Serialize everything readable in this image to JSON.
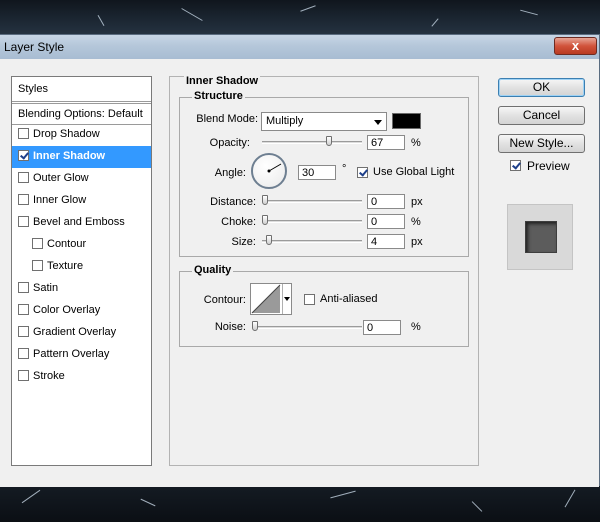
{
  "window": {
    "title": "Layer Style",
    "close_glyph": "x"
  },
  "styles_list": {
    "header": "Styles",
    "blending_options": "Blending Options: Default",
    "items": [
      {
        "label": "Drop Shadow",
        "checked": false,
        "active": false,
        "indent": false
      },
      {
        "label": "Inner Shadow",
        "checked": true,
        "active": true,
        "indent": false
      },
      {
        "label": "Outer Glow",
        "checked": false,
        "active": false,
        "indent": false
      },
      {
        "label": "Inner Glow",
        "checked": false,
        "active": false,
        "indent": false
      },
      {
        "label": "Bevel and Emboss",
        "checked": false,
        "active": false,
        "indent": false
      },
      {
        "label": "Contour",
        "checked": false,
        "active": false,
        "indent": true
      },
      {
        "label": "Texture",
        "checked": false,
        "active": false,
        "indent": true
      },
      {
        "label": "Satin",
        "checked": false,
        "active": false,
        "indent": false
      },
      {
        "label": "Color Overlay",
        "checked": false,
        "active": false,
        "indent": false
      },
      {
        "label": "Gradient Overlay",
        "checked": false,
        "active": false,
        "indent": false
      },
      {
        "label": "Pattern Overlay",
        "checked": false,
        "active": false,
        "indent": false
      },
      {
        "label": "Stroke",
        "checked": false,
        "active": false,
        "indent": false
      }
    ]
  },
  "inner_shadow": {
    "title": "Inner Shadow",
    "structure": {
      "title": "Structure",
      "blend_mode_label": "Blend Mode:",
      "blend_mode_value": "Multiply",
      "shadow_color": "#000000",
      "opacity_label": "Opacity:",
      "opacity_value": "67",
      "opacity_unit": "%",
      "angle_label": "Angle:",
      "angle_value": "30",
      "angle_unit": "°",
      "use_global_light_label": "Use Global Light",
      "use_global_light_checked": true,
      "distance_label": "Distance:",
      "distance_value": "0",
      "distance_unit": "px",
      "choke_label": "Choke:",
      "choke_value": "0",
      "choke_unit": "%",
      "size_label": "Size:",
      "size_value": "4",
      "size_unit": "px"
    },
    "quality": {
      "title": "Quality",
      "contour_label": "Contour:",
      "anti_aliased_label": "Anti-aliased",
      "anti_aliased_checked": false,
      "noise_label": "Noise:",
      "noise_value": "0",
      "noise_unit": "%"
    }
  },
  "buttons": {
    "ok": "OK",
    "cancel": "Cancel",
    "new_style": "New Style...",
    "preview_label": "Preview",
    "preview_checked": true
  },
  "colors": {
    "active_row": "#3399ff",
    "preview_fill": "#5c5c5c"
  }
}
